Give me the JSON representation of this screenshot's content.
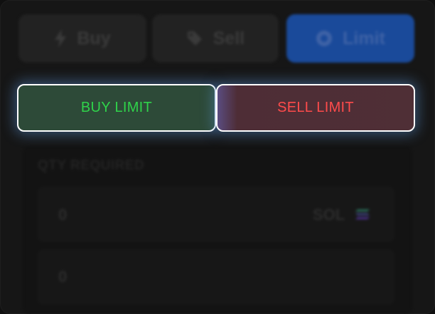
{
  "tabs": [
    {
      "label": "Buy",
      "icon": "lightning-icon"
    },
    {
      "label": "Sell",
      "icon": "tag-icon"
    },
    {
      "label": "Limit",
      "icon": "target-icon"
    }
  ],
  "actions": {
    "buy_limit_label": "BUY LIMIT",
    "sell_limit_label": "SELL LIMIT"
  },
  "qty": {
    "label": "QTY REQUIRED",
    "value_1": "0",
    "unit": "SOL",
    "value_2": "0"
  },
  "colors": {
    "buy_text": "#2fd34a",
    "sell_text": "#ff4b4b",
    "limit_tab": "#1a4a9a"
  }
}
